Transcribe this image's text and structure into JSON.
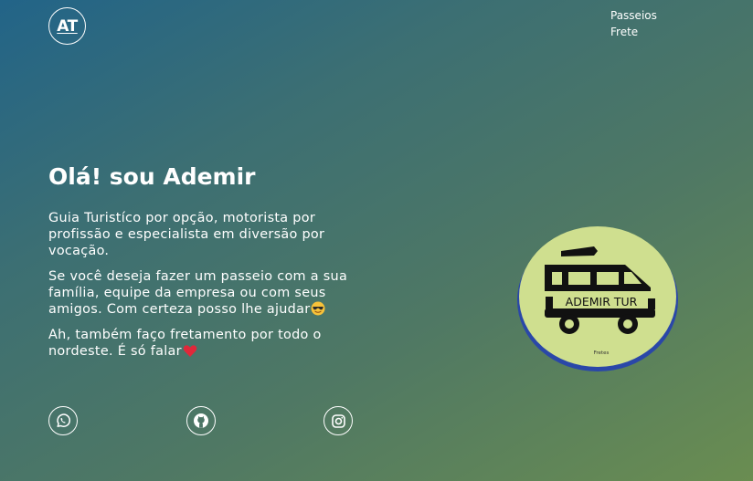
{
  "header": {
    "logo_text": "AT",
    "nav": [
      {
        "label": "Passeios"
      },
      {
        "label": "Frete"
      }
    ]
  },
  "hero": {
    "title": "Olá! sou Ademir",
    "paragraph_1": "Guia Turistíco por opção, motorista por profissão e especialista em diversão por vocação.",
    "paragraph_2": "Se você deseja fazer um passeio com a sua família, equipe da empresa ou com seus amigos. Com certeza posso lhe ajudar",
    "paragraph_3": "Ah, também faço fretamento por todo o nordeste. É só falar"
  },
  "social": [
    {
      "icon": "whatsapp-icon"
    },
    {
      "icon": "github-icon"
    },
    {
      "icon": "instagram-icon"
    }
  ],
  "badge": {
    "brand": "ADEMIR TUR",
    "caption": "Fretes",
    "fill_color": "#cfdf8f",
    "ring_color": "#2a47a8"
  },
  "colors": {
    "gradient_start": "#226488",
    "gradient_end": "#6a8d51"
  }
}
